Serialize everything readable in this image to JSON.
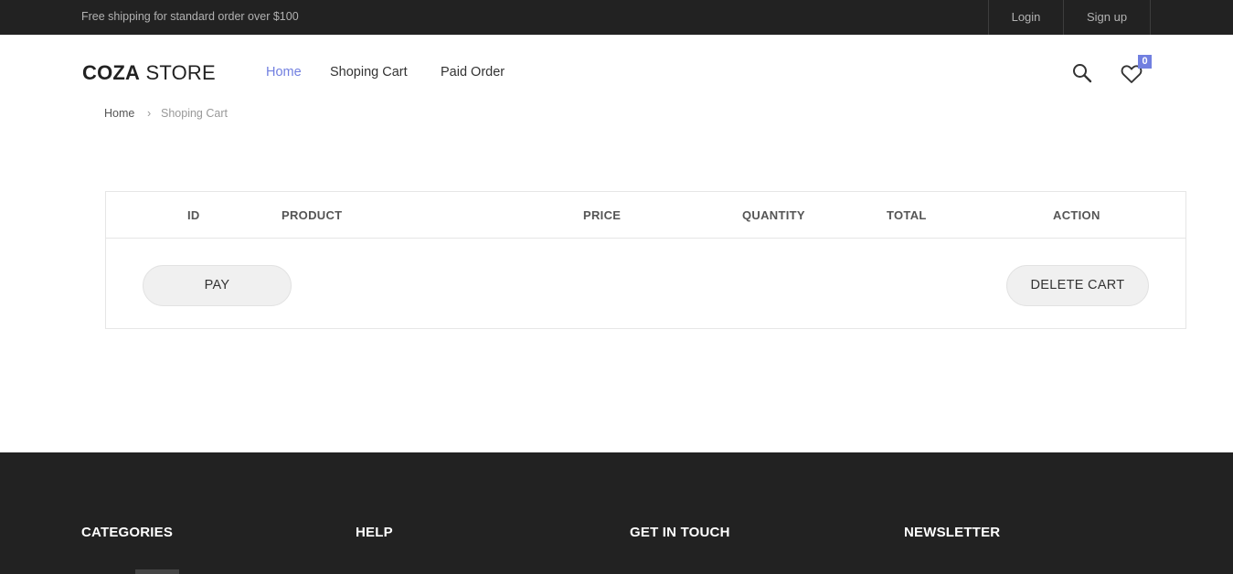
{
  "topbar": {
    "promo": "Free shipping for standard order over $100",
    "login": "Login",
    "signup": "Sign up"
  },
  "header": {
    "logo_bold": "COZA",
    "logo_light": " STORE",
    "nav": [
      {
        "label": "Home",
        "active": true
      },
      {
        "label": "Shoping Cart",
        "active": false
      },
      {
        "label": "Paid Order",
        "active": false
      }
    ],
    "wishlist_count": "0",
    "accent_color": "#717fe0"
  },
  "breadcrumb": {
    "home": "Home",
    "separator": "›",
    "current": "Shoping Cart"
  },
  "cart": {
    "columns": [
      "ID",
      "PRODUCT",
      "PRICE",
      "QUANTITY",
      "TOTAL",
      "ACTION"
    ],
    "rows": [],
    "pay_label": "PAY",
    "delete_label": "DELETE CART"
  },
  "footer": {
    "columns": [
      "CATEGORIES",
      "HELP",
      "GET IN TOUCH",
      "NEWSLETTER"
    ]
  }
}
